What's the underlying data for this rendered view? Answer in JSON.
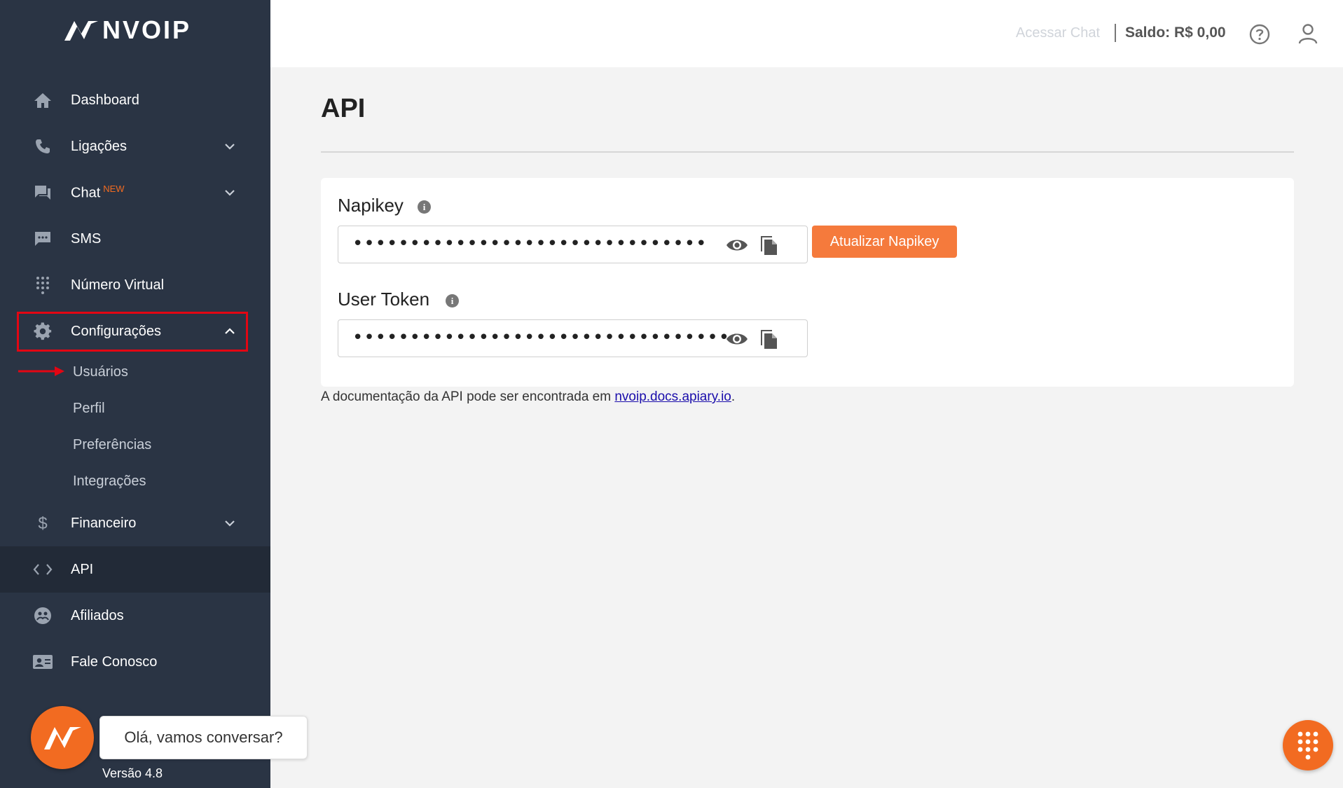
{
  "brand": {
    "name": "NVOIP",
    "accent": "#f26b21",
    "sidebar_bg": "#2a3444"
  },
  "sidebar": {
    "items": [
      {
        "label": "Dashboard",
        "icon": "home-icon"
      },
      {
        "label": "Ligações",
        "icon": "phone-icon",
        "expandable": true
      },
      {
        "label": "Chat",
        "badge": "NEW",
        "icon": "chat-icon",
        "expandable": true
      },
      {
        "label": "SMS",
        "icon": "sms-icon"
      },
      {
        "label": "Número Virtual",
        "icon": "dialpad-icon"
      },
      {
        "label": "Configurações",
        "icon": "gear-icon",
        "expanded": true,
        "subitems": [
          "Usuários",
          "Perfil",
          "Preferências",
          "Integrações"
        ]
      },
      {
        "label": "Financeiro",
        "icon": "dollar-icon",
        "expandable": true
      },
      {
        "label": "API",
        "icon": "code-icon",
        "active": true
      },
      {
        "label": "Afiliados",
        "icon": "affiliates-icon"
      },
      {
        "label": "Fale Conosco",
        "icon": "contact-card-icon"
      }
    ],
    "version": "Versão 4.8"
  },
  "chat_widget": {
    "greeting": "Olá, vamos conversar?"
  },
  "header": {
    "acessar_chat": "Acessar Chat",
    "saldo": "Saldo: R$ 0,00"
  },
  "main": {
    "title": "API",
    "napikey": {
      "label": "Napikey",
      "value": "•••••••••••••••••••••••••••••••",
      "update_button": "Atualizar Napikey"
    },
    "user_token": {
      "label": "User Token",
      "value": "••••••••••••••••••••••••••••••••••"
    },
    "doc_prefix": "A documentação da API pode ser encontrada em ",
    "doc_link": "nvoip.docs.apiary.io",
    "doc_suffix": "."
  }
}
